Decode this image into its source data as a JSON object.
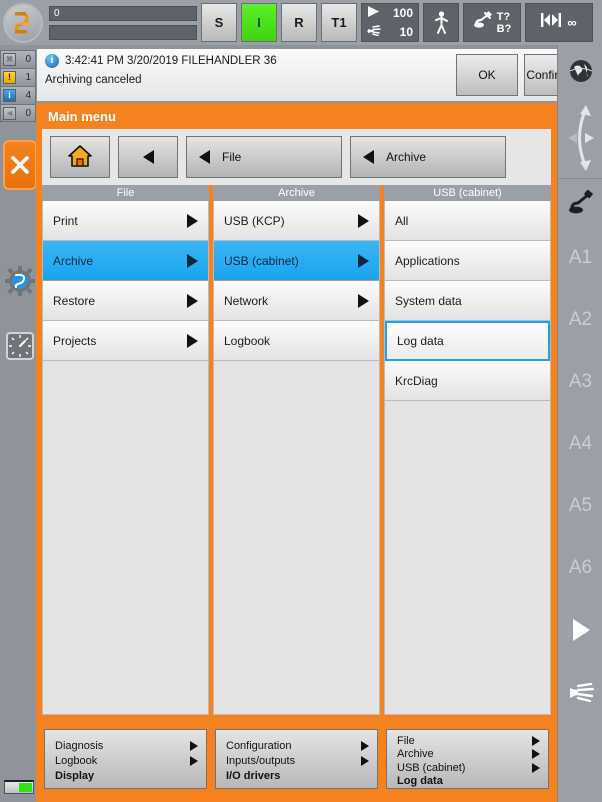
{
  "topbar": {
    "robot_icon": "robot-arm-icon",
    "program_field_value": "0",
    "program_field2_value": "",
    "mode_buttons": [
      {
        "label": "S",
        "active": false
      },
      {
        "label": "I",
        "active": true
      },
      {
        "label": "R",
        "active": false
      },
      {
        "label": "T1",
        "active": false
      }
    ],
    "override_program": "100",
    "override_jog": "10",
    "run_icon": "play-icon",
    "jog_icon": "hand-icon",
    "person_icon": "walking-person-icon",
    "tool_icon": "tool-gripper-icon",
    "tool_t": "T?",
    "tool_b": "B?",
    "step_icon": "step-mode-icon",
    "infinity": "∞"
  },
  "message_counters": [
    {
      "type": "gray",
      "glyph": "✖",
      "count": "0"
    },
    {
      "type": "warn",
      "glyph": "!",
      "count": "1"
    },
    {
      "type": "info",
      "glyph": "i",
      "count": "4"
    },
    {
      "type": "gray",
      "glyph": "◄",
      "count": "0"
    }
  ],
  "message": {
    "icon": "info-circle-icon",
    "time": "3:42:41 PM",
    "date": "3/20/2019",
    "source": "FILEHANDLER 36",
    "header": "3:42:41 PM 3/20/2019 FILEHANDLER 36",
    "body": "Archiving canceled",
    "ok_label": "OK",
    "confirm_all_label": "Confirm all"
  },
  "main": {
    "title": "Main menu",
    "accent_color": "#f5821f",
    "selection_color": "#1aa3ee",
    "nav": {
      "home_icon": "home-icon",
      "back_label": "",
      "file_label": "File",
      "archive_label": "Archive"
    },
    "columns": [
      {
        "header": "File",
        "items": [
          {
            "label": "Print",
            "arrow": true,
            "state": "normal"
          },
          {
            "label": "Archive",
            "arrow": true,
            "state": "selected"
          },
          {
            "label": "Restore",
            "arrow": true,
            "state": "normal"
          },
          {
            "label": "Projects",
            "arrow": true,
            "state": "normal"
          }
        ]
      },
      {
        "header": "Archive",
        "items": [
          {
            "label": "USB (KCP)",
            "arrow": true,
            "state": "normal"
          },
          {
            "label": "USB (cabinet)",
            "arrow": true,
            "state": "selected"
          },
          {
            "label": "Network",
            "arrow": true,
            "state": "normal"
          },
          {
            "label": "Logbook",
            "arrow": false,
            "state": "normal"
          }
        ]
      },
      {
        "header": "USB (cabinet)",
        "items": [
          {
            "label": "All",
            "arrow": false,
            "state": "normal"
          },
          {
            "label": "Applications",
            "arrow": false,
            "state": "normal"
          },
          {
            "label": "System data",
            "arrow": false,
            "state": "normal"
          },
          {
            "label": "Log data",
            "arrow": false,
            "state": "focused"
          },
          {
            "label": "KrcDiag",
            "arrow": false,
            "state": "normal"
          }
        ]
      }
    ]
  },
  "bottom_panels": [
    {
      "rows": [
        {
          "label": "Diagnosis",
          "arrow": true,
          "bold": false
        },
        {
          "label": "Logbook",
          "arrow": true,
          "bold": false
        },
        {
          "label": "Display",
          "arrow": false,
          "bold": true
        }
      ]
    },
    {
      "rows": [
        {
          "label": "Configuration",
          "arrow": true,
          "bold": false
        },
        {
          "label": "Inputs/outputs",
          "arrow": true,
          "bold": false
        },
        {
          "label": "I/O drivers",
          "arrow": false,
          "bold": true
        }
      ]
    },
    {
      "rows": [
        {
          "label": "File",
          "arrow": true,
          "bold": false
        },
        {
          "label": "Archive",
          "arrow": true,
          "bold": false
        },
        {
          "label": "USB (cabinet)",
          "arrow": true,
          "bold": false
        },
        {
          "label": "Log data",
          "arrow": false,
          "bold": true
        }
      ]
    }
  ],
  "left_sidebar": {
    "close_icon": "close-x-icon",
    "gear_icon": "gear-robot-icon",
    "clock_icon": "clock-dial-icon",
    "battery_icon": "battery-icon"
  },
  "right_sidebar": {
    "globe_icon": "world-coordinate-icon",
    "arrows_icon": "jog-direction-icon",
    "tool_icon": "tool-axis-icon",
    "axes": [
      "A1",
      "A2",
      "A3",
      "A4",
      "A5",
      "A6"
    ],
    "play_icon": "play-icon",
    "hand_icon": "hand-icon"
  }
}
